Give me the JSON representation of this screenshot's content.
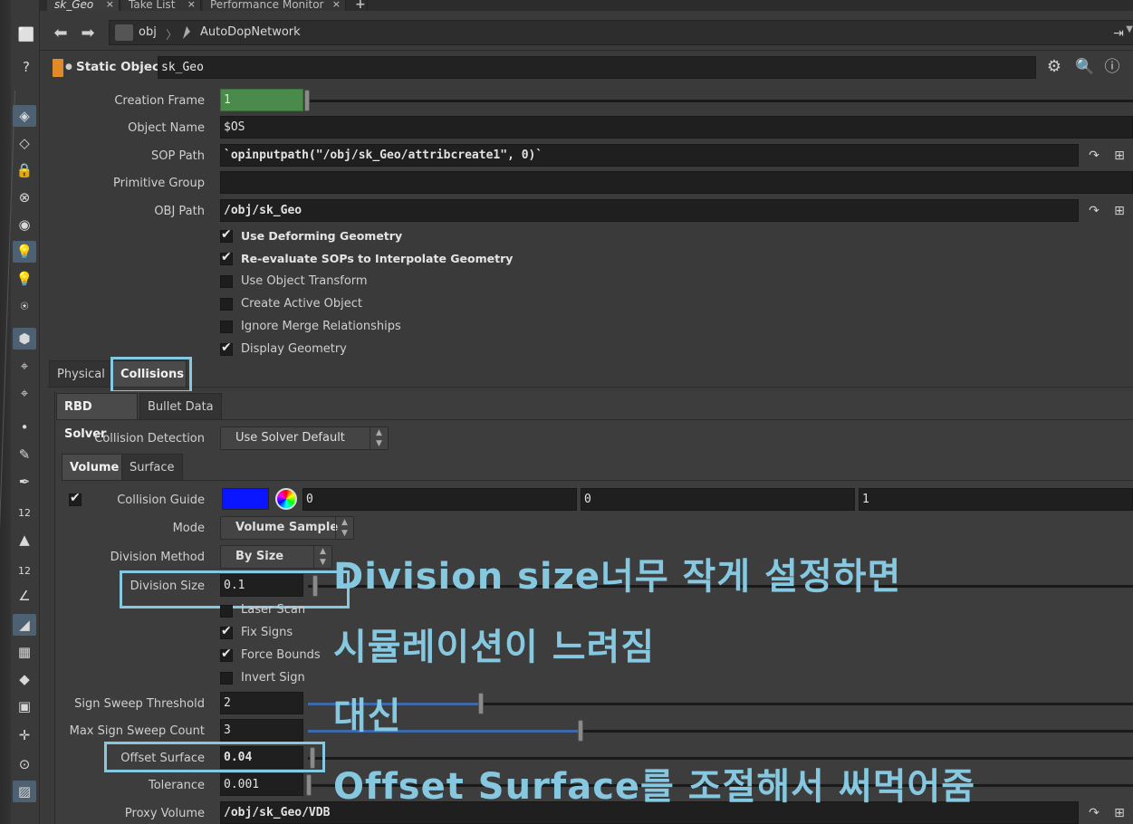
{
  "tabs": [
    {
      "label": "sk_Geo",
      "active": true
    },
    {
      "label": "Take List",
      "active": false
    },
    {
      "label": "Performance Monitor",
      "active": false
    }
  ],
  "tab_close": "×",
  "tab_add": "+",
  "path": {
    "root": "obj",
    "node": "AutoDopNetwork"
  },
  "header": {
    "node_type": "Static Object",
    "node_name": "sk_Geo"
  },
  "params": {
    "creation_frame": {
      "label": "Creation Frame",
      "value": "1"
    },
    "object_name": {
      "label": "Object Name",
      "value": "$OS"
    },
    "sop_path": {
      "label": "SOP Path",
      "value": "`opinputpath(\"/obj/sk_Geo/attribcreate1\", 0)`"
    },
    "primitive_group": {
      "label": "Primitive Group",
      "value": ""
    },
    "obj_path": {
      "label": "OBJ Path",
      "value": "/obj/sk_Geo"
    }
  },
  "checkboxes": [
    {
      "label": "Use Deforming Geometry",
      "checked": true,
      "strong": true
    },
    {
      "label": "Re-evaluate SOPs to Interpolate Geometry",
      "checked": true,
      "strong": true
    },
    {
      "label": "Use Object Transform",
      "checked": false,
      "strong": false
    },
    {
      "label": "Create Active Object",
      "checked": false,
      "strong": false
    },
    {
      "label": "Ignore Merge Relationships",
      "checked": false,
      "strong": false
    },
    {
      "label": "Display Geometry",
      "checked": true,
      "strong": false
    }
  ],
  "main_tabs": [
    {
      "label": "Physical",
      "selected": false
    },
    {
      "label": "Collisions",
      "selected": true
    }
  ],
  "sub_tabs": [
    {
      "label": "RBD Solver",
      "selected": true
    },
    {
      "label": "Bullet Data",
      "selected": false
    }
  ],
  "collision_detection": {
    "label": "Collision Detection",
    "value": "Use Solver Default"
  },
  "vol_tabs": [
    {
      "label": "Volume",
      "selected": true
    },
    {
      "label": "Surface",
      "selected": false
    }
  ],
  "collision_guide": {
    "label": "Collision Guide",
    "color": "#0a16ff",
    "r": "0",
    "g": "0",
    "b": "1",
    "checked": true
  },
  "mode": {
    "label": "Mode",
    "value": "Volume Sample"
  },
  "division_method": {
    "label": "Division Method",
    "value": "By Size"
  },
  "division_size": {
    "label": "Division Size",
    "value": "0.1"
  },
  "laser_scan": {
    "label": "Laser Scan",
    "checked": false
  },
  "fix_signs": {
    "label": "Fix Signs",
    "checked": true
  },
  "force_bounds": {
    "label": "Force Bounds",
    "checked": true
  },
  "invert_sign": {
    "label": "Invert Sign",
    "checked": false
  },
  "sign_sweep_threshold": {
    "label": "Sign Sweep Threshold",
    "value": "2",
    "fraction": 0.21
  },
  "max_sign_sweep_count": {
    "label": "Max Sign Sweep Count",
    "value": "3",
    "fraction": 0.33
  },
  "offset_surface": {
    "label": "Offset Surface",
    "value": "0.04"
  },
  "tolerance": {
    "label": "Tolerance",
    "value": "0.001"
  },
  "proxy_volume": {
    "label": "Proxy Volume",
    "value": "/obj/sk_Geo/VDB"
  },
  "annotations": {
    "line1": "Division size너무 작게 설정하면",
    "line2": "시뮬레이션이 느려짐",
    "line3": "대신",
    "line4": "Offset Surface를 조절해서 써먹어줌"
  },
  "colors": {
    "accent": "#86c8e0",
    "creation_frame_fill": "#4a8a4a",
    "slider_fill": "#3f68a8"
  }
}
